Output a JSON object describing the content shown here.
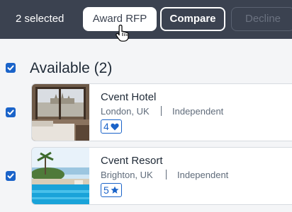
{
  "toolbar": {
    "selected_text": "2 selected",
    "award_label": "Award RFP",
    "compare_label": "Compare",
    "decline_label": "Decline"
  },
  "group": {
    "title": "Available (2)",
    "checked": true
  },
  "hotels": [
    {
      "name": "Cvent Hotel",
      "location": "London, UK",
      "type": "Independent",
      "rating": "4",
      "rating_icon": "heart-icon",
      "checked": true
    },
    {
      "name": "Cvent Resort",
      "location": "Brighton, UK",
      "type": "Independent",
      "rating": "5",
      "rating_icon": "star-icon",
      "checked": true
    }
  ],
  "colors": {
    "toolbar_bg": "#3b4250",
    "accent": "#1a63c9"
  }
}
